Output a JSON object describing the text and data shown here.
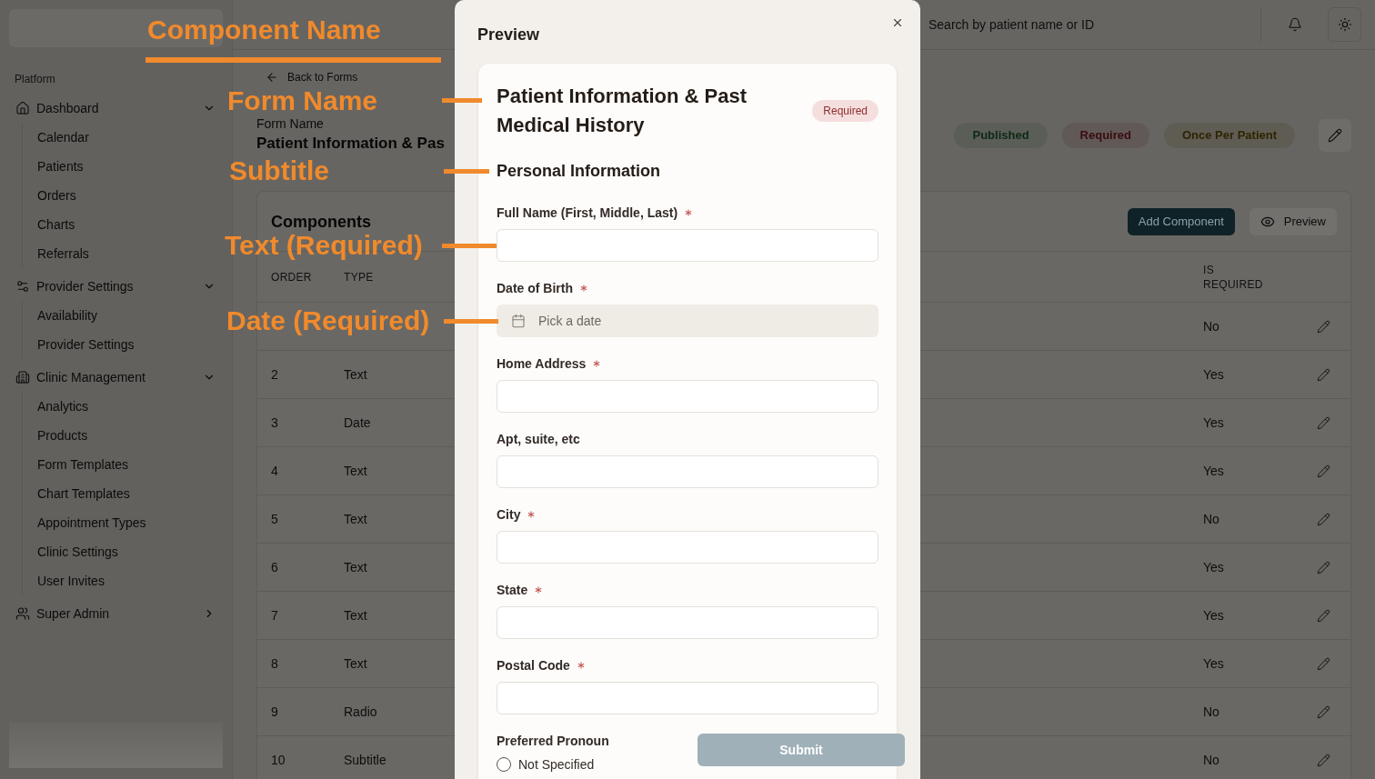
{
  "sidebar": {
    "section_label": "Platform",
    "groups": [
      {
        "label": "Dashboard",
        "expanded": true,
        "children": [
          {
            "label": "Calendar"
          },
          {
            "label": "Patients"
          },
          {
            "label": "Orders"
          },
          {
            "label": "Charts"
          },
          {
            "label": "Referrals"
          }
        ]
      },
      {
        "label": "Provider Settings",
        "expanded": true,
        "children": [
          {
            "label": "Availability"
          },
          {
            "label": "Provider Settings"
          }
        ]
      },
      {
        "label": "Clinic Management",
        "expanded": true,
        "children": [
          {
            "label": "Analytics"
          },
          {
            "label": "Products"
          },
          {
            "label": "Form Templates"
          },
          {
            "label": "Chart Templates"
          },
          {
            "label": "Appointment Types"
          },
          {
            "label": "Clinic Settings"
          },
          {
            "label": "User Invites"
          }
        ]
      },
      {
        "label": "Super Admin",
        "expanded": false
      }
    ]
  },
  "header": {
    "search": {
      "placeholder": "Search by patient name or ID"
    }
  },
  "page": {
    "back_link": "Back to Forms",
    "form_name": {
      "label": "Form Name",
      "value": "Patient Information & Pas"
    },
    "badges": [
      {
        "label": "Published",
        "color": "#0c2a14"
      },
      {
        "label": "Required",
        "color": "#3a0c10"
      },
      {
        "label": "Once Per Patient",
        "color": "#2e2400"
      }
    ]
  },
  "components": {
    "title": "Components",
    "buttons": [
      {
        "label": "Add Component",
        "kind": "primary"
      },
      {
        "label": "Preview",
        "kind": "secondary"
      }
    ],
    "columns": [
      "ORDER",
      "TYPE",
      "IS REQUIRED"
    ],
    "rows": [
      {
        "is_required": "No"
      },
      {
        "order": "2",
        "type": "Text",
        "is_required": "Yes"
      },
      {
        "order": "3",
        "type": "Date",
        "is_required": "Yes"
      },
      {
        "order": "4",
        "type": "Text",
        "is_required": "Yes"
      },
      {
        "order": "5",
        "type": "Text",
        "is_required": "No"
      },
      {
        "order": "6",
        "type": "Text",
        "is_required": "Yes"
      },
      {
        "order": "7",
        "type": "Text",
        "is_required": "Yes"
      },
      {
        "order": "8",
        "type": "Text",
        "is_required": "Yes"
      },
      {
        "order": "9",
        "type": "Radio",
        "is_required": "No"
      },
      {
        "order": "10",
        "type": "Subtitle",
        "is_required": "No"
      }
    ]
  },
  "modal": {
    "title": "Preview",
    "form": {
      "title": "Patient Information & Past Medical History",
      "badge": "Required",
      "subtitle": "Personal Information",
      "fields": [
        {
          "kind": "text",
          "label": "Full Name (First, Middle, Last)",
          "required": true
        },
        {
          "kind": "date",
          "label": "Date of Birth",
          "required": true,
          "placeholder": "Pick a date"
        },
        {
          "kind": "text",
          "label": "Home Address",
          "required": true
        },
        {
          "kind": "text",
          "label": "Apt, suite, etc",
          "required": false
        },
        {
          "kind": "text",
          "label": "City",
          "required": true
        },
        {
          "kind": "text",
          "label": "State",
          "required": true
        },
        {
          "kind": "text",
          "label": "Postal Code",
          "required": true
        },
        {
          "kind": "radio",
          "label": "Preferred Pronoun",
          "required": false,
          "options": [
            {
              "label": "Not Specified",
              "selected": false
            }
          ]
        }
      ]
    },
    "submit": {
      "label": "Submit",
      "disabled": true
    }
  },
  "annotations": [
    {
      "label": "Component Name",
      "kind": "underline"
    },
    {
      "label": "Form Name",
      "kind": "leader"
    },
    {
      "label": "Subtitle",
      "kind": "leader"
    },
    {
      "label": "Text (Required)",
      "kind": "leader"
    },
    {
      "label": "Date (Required)",
      "kind": "leader"
    }
  ]
}
